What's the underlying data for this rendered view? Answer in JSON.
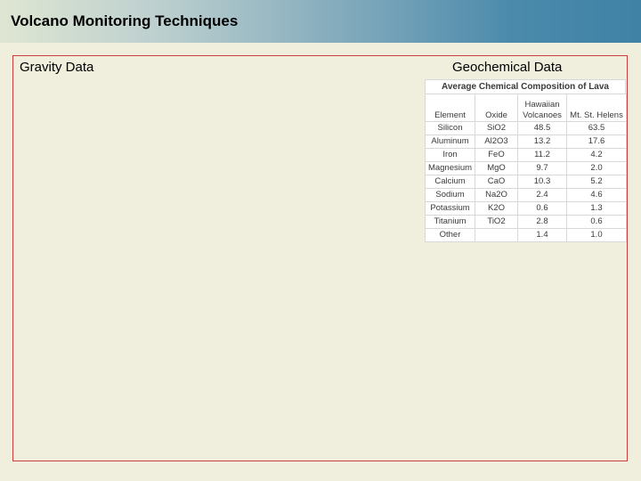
{
  "title": "Volcano Monitoring Techniques",
  "left": {
    "heading": "Gravity Data"
  },
  "right": {
    "heading": "Geochemical Data",
    "table": {
      "caption": "Average Chemical Composition of Lava",
      "columns": [
        "Element",
        "Oxide",
        "Hawaiian Volcanoes",
        "Mt. St. Helens"
      ],
      "rows": [
        [
          "Silicon",
          "SiO2",
          "48.5",
          "63.5"
        ],
        [
          "Aluminum",
          "Al2O3",
          "13.2",
          "17.6"
        ],
        [
          "Iron",
          "FeO",
          "11.2",
          "4.2"
        ],
        [
          "Magnesium",
          "MgO",
          "9.7",
          "2.0"
        ],
        [
          "Calcium",
          "CaO",
          "10.3",
          "5.2"
        ],
        [
          "Sodium",
          "Na2O",
          "2.4",
          "4.6"
        ],
        [
          "Potassium",
          "K2O",
          "0.6",
          "1.3"
        ],
        [
          "Titanium",
          "TiO2",
          "2.8",
          "0.6"
        ],
        [
          "Other",
          "",
          "1.4",
          "1.0"
        ]
      ]
    }
  }
}
